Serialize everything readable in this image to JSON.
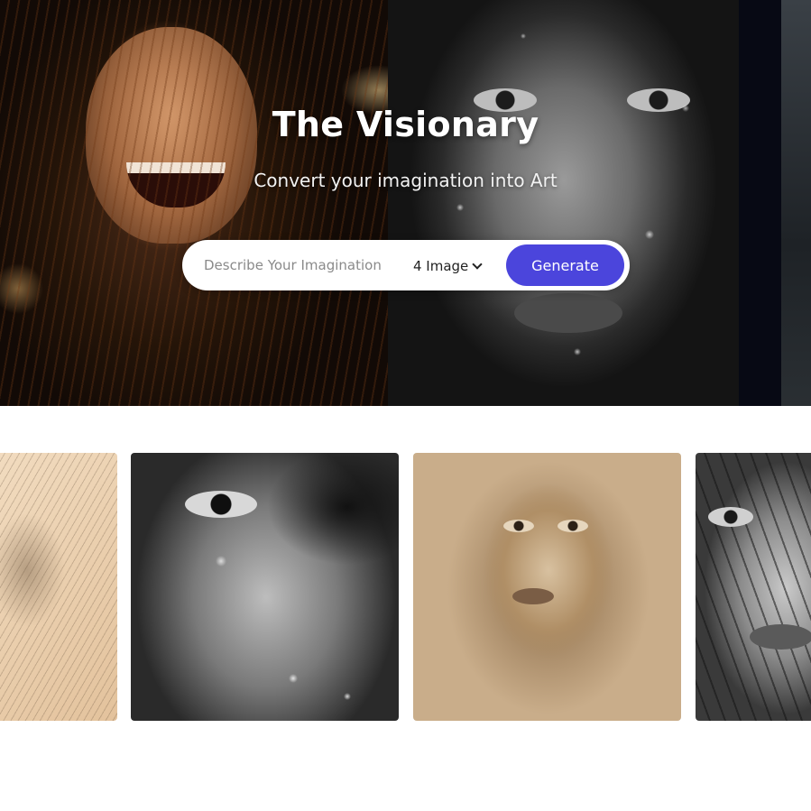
{
  "hero": {
    "title": "The Visionary",
    "subtitle": "Convert your imagination into Art"
  },
  "search": {
    "placeholder": "Describe Your Imagination",
    "count_value": "4 Image",
    "generate_label": "Generate"
  },
  "colors": {
    "accent": "#4b45dc",
    "page_background": "#ffffff",
    "hero_dark_strip": "#070914"
  },
  "gallery": {
    "items": [
      {
        "style": "pencil sketch"
      },
      {
        "style": "black and white wet face"
      },
      {
        "style": "sepia pencil portrait"
      },
      {
        "style": "black and white wet hair"
      }
    ]
  },
  "icons": {
    "count_dropdown": "chevron-down-icon"
  }
}
